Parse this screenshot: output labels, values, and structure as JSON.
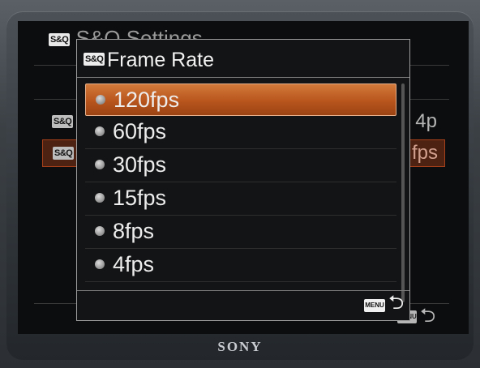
{
  "background_screen": {
    "title": "S&Q Settings",
    "badge": "S&Q",
    "rows": [
      {
        "badge": "S&Q",
        "value": "4p"
      },
      {
        "badge": "S&Q",
        "value": "fps"
      }
    ],
    "back_menu_label": "MENU",
    "back_arrow_glyph": "⮌"
  },
  "popup": {
    "badge": "S&Q",
    "title": "Frame Rate",
    "options": [
      "120fps",
      "60fps",
      "30fps",
      "15fps",
      "8fps",
      "4fps"
    ],
    "selected_option": "120fps",
    "footer": {
      "menu_label": "MENU",
      "back_arrow_glyph": "⮌"
    }
  },
  "device": {
    "brand": "SONY"
  },
  "colors": {
    "selection": "#c0601f",
    "popup_border": "#9e9e9e",
    "background": "#0c0d0e"
  },
  "icons": {
    "option_marker": "radio-dot-icon",
    "menu_button": "menu-button-icon",
    "back": "return-arrow-icon"
  }
}
